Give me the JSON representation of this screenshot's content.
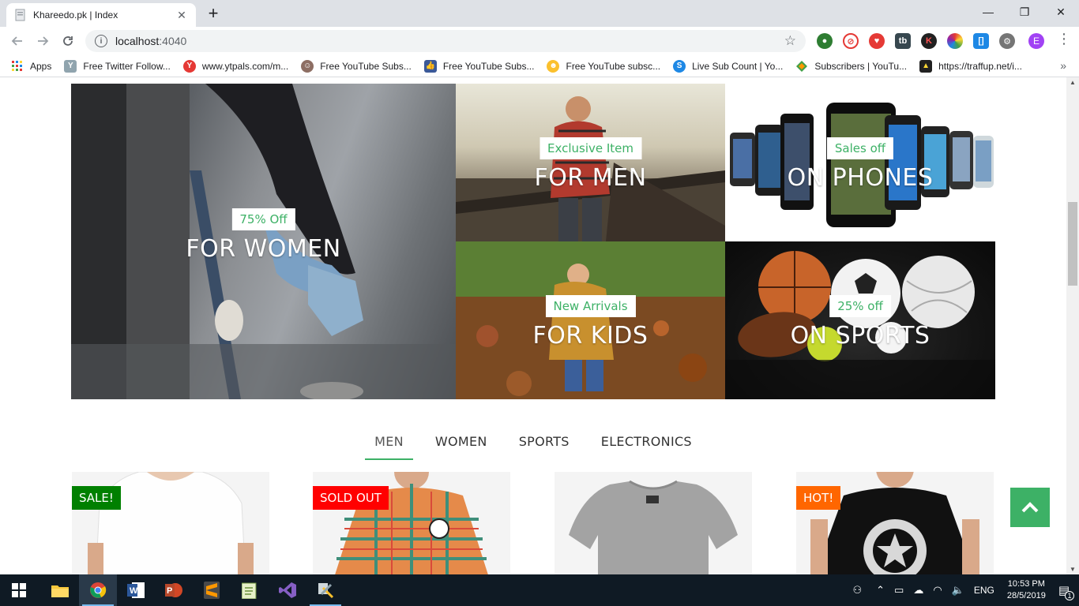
{
  "browser": {
    "tab_title": "Khareedo.pk | Index",
    "url_host": "localhost",
    "url_port": ":4040",
    "profile_initial": "E",
    "bookmarks": [
      {
        "label": "Apps",
        "icon": "apps-grid-icon"
      },
      {
        "label": "Free Twitter Follow...",
        "icon": "y-logo-icon"
      },
      {
        "label": "www.ytpals.com/m...",
        "icon": "ytpals-icon"
      },
      {
        "label": "Free YouTube Subs...",
        "icon": "face-icon"
      },
      {
        "label": "Free YouTube Subs...",
        "icon": "thumbs-up-icon"
      },
      {
        "label": "Free YouTube subsc...",
        "icon": "emoji-icon"
      },
      {
        "label": "Live Sub Count | Yo...",
        "icon": "s-logo-icon"
      },
      {
        "label": "Subscribers | YouTu...",
        "icon": "diamond-icon"
      },
      {
        "label": "https://traffup.net/i...",
        "icon": "arrow-up-icon"
      }
    ]
  },
  "banners": {
    "women": {
      "label": "75% Off",
      "title": "FOR WOMEN"
    },
    "men": {
      "label": "Exclusive Item",
      "title": "FOR MEN"
    },
    "phones": {
      "label": "Sales off",
      "title": "ON PHONES"
    },
    "kids": {
      "label": "New Arrivals",
      "title": "FOR KIDS"
    },
    "sports": {
      "label": "25% off",
      "title": "ON SPORTS"
    }
  },
  "categories": [
    "MEN",
    "WOMEN",
    "SPORTS",
    "ELECTRONICS"
  ],
  "products": [
    {
      "badge": "SALE!",
      "badge_color": "#008000"
    },
    {
      "badge": "SOLD OUT",
      "badge_color": "#ff0000"
    },
    {
      "badge": "",
      "badge_color": ""
    },
    {
      "badge": "HOT!",
      "badge_color": "#ff6600"
    }
  ],
  "taskbar": {
    "language": "ENG",
    "time": "10:53 PM",
    "date": "28/5/2019",
    "notification_count": "1"
  },
  "colors": {
    "accent": "#3db166"
  }
}
